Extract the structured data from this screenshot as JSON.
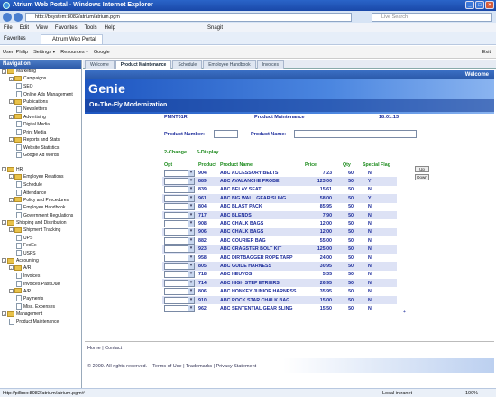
{
  "window": {
    "title": "Atrium Web Portal - Windows Internet Explorer",
    "url": "http://bsystem:8082/atrium/atrium.pgm",
    "search_placeholder": "Live Search"
  },
  "menu": [
    "File",
    "Edit",
    "View",
    "Favorites",
    "Tools",
    "Help"
  ],
  "menu_right": [
    "Snagit"
  ],
  "favorites": {
    "label": "Favorites",
    "tab": "Atrium Web Portal"
  },
  "toolbar": {
    "user": "User: Philip",
    "settings": "Settings",
    "resources": "Resources",
    "google": "Google",
    "exit": "Exit"
  },
  "nav": {
    "header": "Navigation",
    "items": [
      {
        "t": "Marketing",
        "lvl": 0,
        "type": "fold",
        "pm": "-"
      },
      {
        "t": "Campaigns",
        "lvl": 1,
        "type": "fold",
        "pm": "-"
      },
      {
        "t": "SEO",
        "lvl": 2,
        "type": "page"
      },
      {
        "t": "Online Ads Management",
        "lvl": 2,
        "type": "page"
      },
      {
        "t": "Publications",
        "lvl": 1,
        "type": "fold",
        "pm": "-"
      },
      {
        "t": "Newsletters",
        "lvl": 2,
        "type": "page"
      },
      {
        "t": "Advertising",
        "lvl": 1,
        "type": "fold",
        "pm": "-"
      },
      {
        "t": "Digital Media",
        "lvl": 2,
        "type": "page"
      },
      {
        "t": "Print Media",
        "lvl": 2,
        "type": "page"
      },
      {
        "t": "Reports and Stats",
        "lvl": 1,
        "type": "fold",
        "pm": "-"
      },
      {
        "t": "Website Statistics",
        "lvl": 2,
        "type": "page"
      },
      {
        "t": "Google Ad Words",
        "lvl": 2,
        "type": "page"
      },
      {
        "t": "",
        "lvl": 0,
        "type": "blank"
      },
      {
        "t": "HR",
        "lvl": 0,
        "type": "fold",
        "pm": "-"
      },
      {
        "t": "Employee Relations",
        "lvl": 1,
        "type": "fold",
        "pm": "-"
      },
      {
        "t": "Schedule",
        "lvl": 2,
        "type": "page"
      },
      {
        "t": "Attendance",
        "lvl": 2,
        "type": "page"
      },
      {
        "t": "Policy and Procedures",
        "lvl": 1,
        "type": "fold",
        "pm": "-"
      },
      {
        "t": "Employee Handbook",
        "lvl": 2,
        "type": "page"
      },
      {
        "t": "Government Regulations",
        "lvl": 2,
        "type": "page"
      },
      {
        "t": "Shipping and Distribution",
        "lvl": 0,
        "type": "fold",
        "pm": "-"
      },
      {
        "t": "Shipment Tracking",
        "lvl": 1,
        "type": "fold",
        "pm": "-"
      },
      {
        "t": "UPS",
        "lvl": 2,
        "type": "page"
      },
      {
        "t": "FedEx",
        "lvl": 2,
        "type": "page"
      },
      {
        "t": "USPS",
        "lvl": 2,
        "type": "page"
      },
      {
        "t": "Accounting",
        "lvl": 0,
        "type": "fold",
        "pm": "-"
      },
      {
        "t": "A/R",
        "lvl": 1,
        "type": "fold",
        "pm": "-"
      },
      {
        "t": "Invoices",
        "lvl": 2,
        "type": "page"
      },
      {
        "t": "Invoices Past Due",
        "lvl": 2,
        "type": "page"
      },
      {
        "t": "A/P",
        "lvl": 1,
        "type": "fold",
        "pm": "-"
      },
      {
        "t": "Payments",
        "lvl": 2,
        "type": "page"
      },
      {
        "t": "Misc. Expenses",
        "lvl": 2,
        "type": "page"
      },
      {
        "t": "Management",
        "lvl": 0,
        "type": "fold",
        "pm": "-"
      },
      {
        "t": "Product Maintenance",
        "lvl": 1,
        "type": "page"
      }
    ]
  },
  "tabs": [
    "Welcome",
    "Product Maintenance",
    "Schedule",
    "Employee Handbook",
    "Invoices"
  ],
  "active_tab": 1,
  "welcome": "Welcome",
  "banner": {
    "logo": "Genie",
    "sub": "On-The-Fly Modernization"
  },
  "form": {
    "pgm": "PMNT01R",
    "title": "Product Maintenance",
    "time": "18:01:13",
    "num_label": "Product Number:",
    "name_label": "Product Name:",
    "opt1": "2-Change",
    "opt2": "5-Display",
    "up": "Up",
    "down": "Down"
  },
  "table": {
    "headers": [
      "Opt",
      "Product",
      "Product Name",
      "Price",
      "Qty",
      "Special Flag"
    ],
    "rows": [
      [
        "904",
        "ABC ACCESSORY BELTS",
        "7.23",
        "60",
        "N"
      ],
      [
        "889",
        "ABC AVALANCHE PROBE",
        "123.00",
        "50",
        "Y"
      ],
      [
        "839",
        "ABC BELAY SEAT",
        "15.61",
        "50",
        "N"
      ],
      [
        "961",
        "ABC BIG WALL GEAR SLING",
        "58.00",
        "50",
        "Y"
      ],
      [
        "804",
        "ABC BLAST PACK",
        "85.95",
        "50",
        "N"
      ],
      [
        "717",
        "ABC BLENDS",
        "7.90",
        "50",
        "N"
      ],
      [
        "908",
        "ABC CHALK BAGS",
        "12.00",
        "50",
        "N"
      ],
      [
        "906",
        "ABC CHALK BAGS",
        "12.00",
        "50",
        "N"
      ],
      [
        "882",
        "ABC COURIER BAG",
        "55.00",
        "50",
        "N"
      ],
      [
        "923",
        "ABC CRAGSTER BOLT KIT",
        "125.00",
        "50",
        "N"
      ],
      [
        "958",
        "ABC DIRTBAGGER ROPE TARP",
        "24.00",
        "50",
        "N"
      ],
      [
        "805",
        "ABC GUIDE HARNESS",
        "30.95",
        "50",
        "N"
      ],
      [
        "718",
        "ABC HEUVOS",
        "5.35",
        "50",
        "N"
      ],
      [
        "714",
        "ABC HIGH STEP ETRIERS",
        "26.95",
        "50",
        "N"
      ],
      [
        "806",
        "ABC HONKEY JUNIOR HARNESS",
        "35.95",
        "50",
        "N"
      ],
      [
        "910",
        "ABC ROCK STAR CHALK BAG",
        "15.00",
        "50",
        "N"
      ],
      [
        "962",
        "ABC SENTENTIAL GEAR SLING",
        "15.50",
        "50",
        "N"
      ]
    ],
    "more": "+"
  },
  "footer": {
    "home": "Home",
    "contact": "Contact",
    "copy": "© 2009. All rights reserved.",
    "terms": "Terms of Use",
    "trademarks": "Trademarks",
    "privacy": "Privacy Statement"
  },
  "status": {
    "left": "http://pilbox:8082/atrium/atrium.pgm#",
    "zone": "Local intranet",
    "zoom": "100%"
  }
}
